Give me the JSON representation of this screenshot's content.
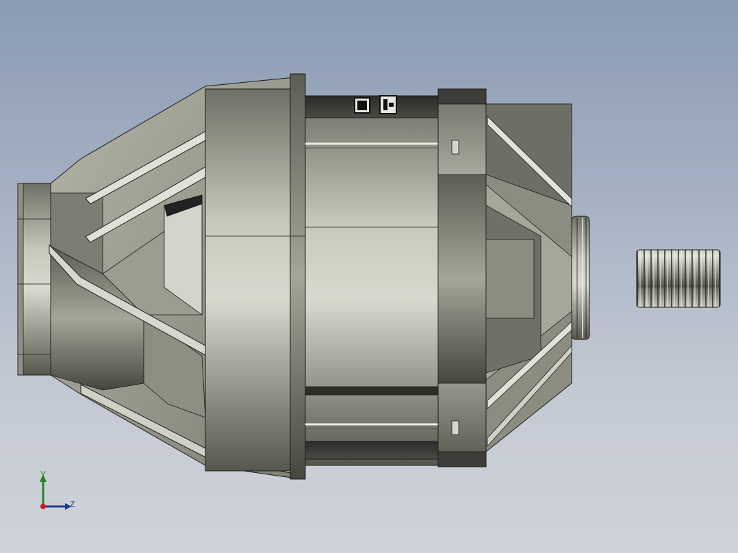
{
  "viewport": {
    "background_top": "#8a9bb3",
    "background_bottom": "#cfd3da"
  },
  "model": {
    "body_color": "#a9aa9c",
    "shadow_color": "#55574d",
    "highlight_color": "#d6d7cc",
    "edge_color": "#1a1a1a"
  },
  "triad": {
    "y_label": "Y",
    "z_label": "Z",
    "y_color": "#1b8a1b",
    "z_color": "#1d3a8a",
    "origin_color": "#c41f1f"
  }
}
